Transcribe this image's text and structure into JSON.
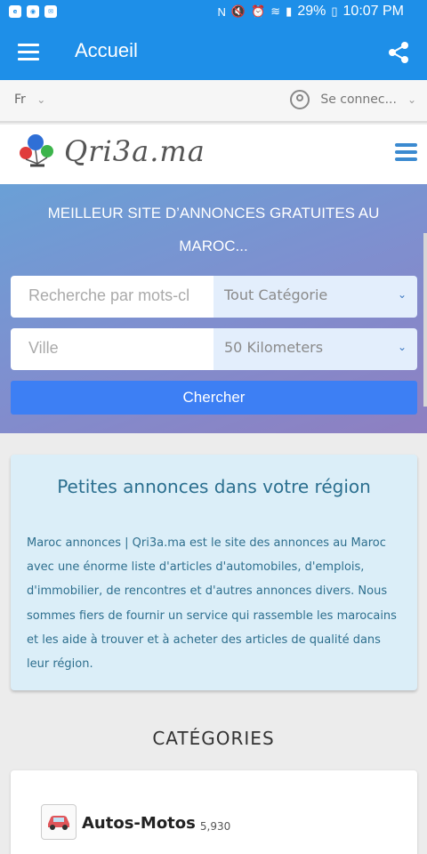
{
  "status_bar": {
    "time": "10:07 PM",
    "battery": "29%",
    "notification_icons": [
      "ebay-icon",
      "messenger-icon",
      "mail-icon"
    ]
  },
  "app_bar": {
    "title": "Accueil"
  },
  "top_row": {
    "language": "Fr",
    "login": "Se connec..."
  },
  "site": {
    "logo_text": "Qri3a.ma"
  },
  "hero": {
    "title": "MEILLEUR SITE D’ANNONCES GRATUITES AU MAROC...",
    "keyword_placeholder": "Recherche par mots-cl",
    "category_select": "Tout Catégorie",
    "city_placeholder": "Ville",
    "distance_select": "50 Kilometers",
    "search_button": "Chercher"
  },
  "info": {
    "title": "Petites annonces dans votre région",
    "text": "Maroc annonces | Qri3a.ma est le site des annonces au Maroc avec une énorme liste d'articles d'automobiles, d'emplois, d'immobilier, de rencontres et d'autres annonces divers. Nous sommes fiers de fournir un service qui rassemble les marocains et les aide à trouver et à acheter des articles de qualité dans leur région."
  },
  "categories": {
    "heading": "CATÉGORIES",
    "items": [
      {
        "name": "Autos-Motos",
        "count": "5,930",
        "icon": "car-icon"
      }
    ]
  },
  "colors": {
    "app_bar": "#1e8fe8",
    "search_button": "#3d7ff4",
    "info_card": "#dbeef8",
    "info_text": "#2e6f8e"
  }
}
